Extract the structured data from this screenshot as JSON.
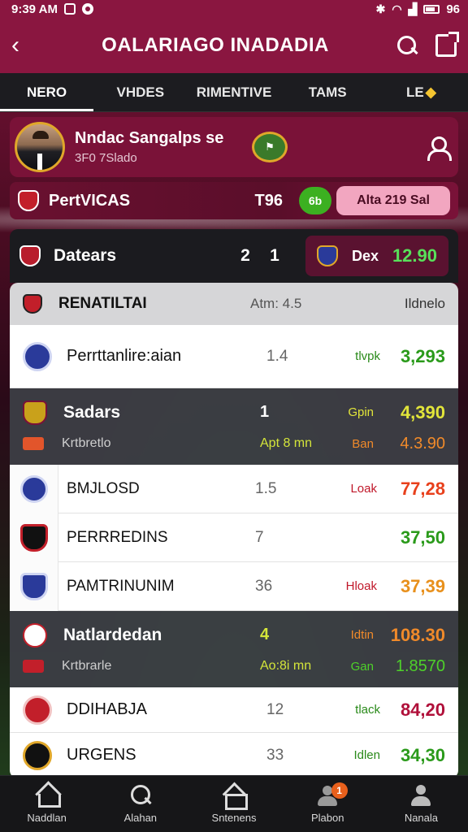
{
  "status_bar": {
    "time": "9:39 AM",
    "battery": "96"
  },
  "app_bar": {
    "title": "OALARIAGO INADADIA"
  },
  "tabs": [
    {
      "label": "NERO"
    },
    {
      "label": "VHDES"
    },
    {
      "label": "RIMENTIVE"
    },
    {
      "label": "TAMS"
    },
    {
      "label": "LE"
    }
  ],
  "profile": {
    "name": "Nndac Sangalps  se",
    "subtitle": "3F0 7Slado"
  },
  "team_strip": {
    "name": "PertVICAS",
    "score": "T96",
    "green_pill": "6b",
    "pink_pill": "Alta 219 Sal"
  },
  "league_header": {
    "name": "Datears",
    "score1": "2",
    "score2": "1",
    "box_label": "Dex",
    "box_value": "12.90"
  },
  "subheader": {
    "name": "RENATILTAI",
    "mid": "Atm: 4.5",
    "right": "Ildnelo"
  },
  "row_first": {
    "name": "Perrttanlire:aian",
    "mid": "1.4",
    "label": "tlvpk",
    "value": "3,293"
  },
  "group1": {
    "name": "Sadars",
    "num": "1",
    "label": "Gpin",
    "value": "4,390",
    "sub": "Krtbretlo",
    "sub_mid": "Apt 8 mn",
    "sub_label": "Ban",
    "sub_value": "4.3.90"
  },
  "list2": [
    {
      "name": "BMJLOSD",
      "mid": "1.5",
      "label": "Loak",
      "value": "77,28",
      "label_color": "#c0182a",
      "value_color": "#e8401c"
    },
    {
      "name": "PERRREDINS",
      "mid": "7",
      "label": "",
      "value": "37,50",
      "label_color": "#2a8a1a",
      "value_color": "#2a9a1a"
    },
    {
      "name": "PAMTRINUNIM",
      "mid": "36",
      "label": "Hloak",
      "value": "37,39",
      "label_color": "#c0182a",
      "value_color": "#e8901c"
    }
  ],
  "group2": {
    "name": "Natlardedan",
    "num": "4",
    "label": "Idtin",
    "value": "108.30",
    "sub": "Krtbrarle",
    "sub_mid": "Ao:8i mn",
    "sub_label": "Gan",
    "sub_value": "1.8570"
  },
  "list3": [
    {
      "name": "DDIHABJA",
      "mid": "12",
      "label": "tlack",
      "value": "84,20",
      "label_color": "#2a8a1a",
      "value_color": "#b0103a"
    },
    {
      "name": "URGENS",
      "mid": "33",
      "label": "Idlen",
      "value": "34,30",
      "label_color": "#2a8a1a",
      "value_color": "#2a9a1a"
    }
  ],
  "bottom_nav": [
    {
      "label": "Naddlan",
      "icon": "home-icon"
    },
    {
      "label": "Alahan",
      "icon": "search-icon"
    },
    {
      "label": "Sntenens",
      "icon": "store-icon"
    },
    {
      "label": "Plabon",
      "icon": "people-icon",
      "badge": "1"
    },
    {
      "label": "Nanala",
      "icon": "person-icon"
    }
  ]
}
